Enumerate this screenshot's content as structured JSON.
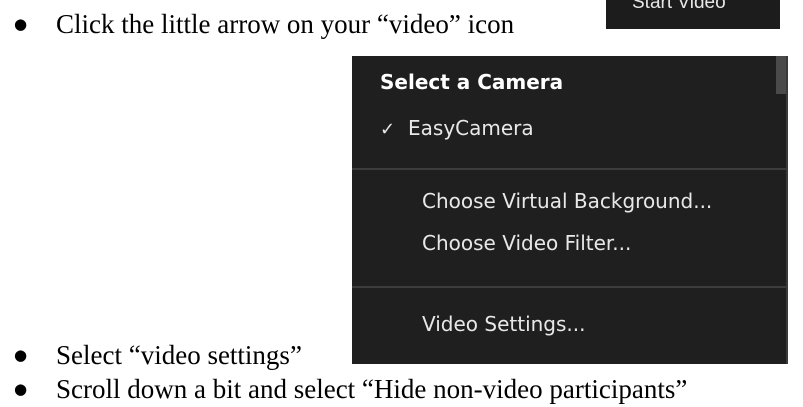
{
  "instructions": [
    {
      "bullet": "●",
      "text": "Click the little arrow on your “video” icon"
    },
    {
      "bullet": "●",
      "text": "Select “video settings”"
    },
    {
      "bullet": "●",
      "text": "Scroll down a bit and select “Hide non-video participants”"
    }
  ],
  "start_video_button": {
    "label": "Start Video"
  },
  "camera_menu": {
    "header": "Select a Camera",
    "selected_camera": "EasyCamera",
    "check_icon": "✓",
    "items": [
      "Choose Virtual Background...",
      "Choose Video Filter...",
      "Video Settings..."
    ]
  },
  "colors": {
    "menu_background": "#1f1f1f",
    "menu_text": "#e8e8e8",
    "button_background": "#1c1c1c"
  }
}
